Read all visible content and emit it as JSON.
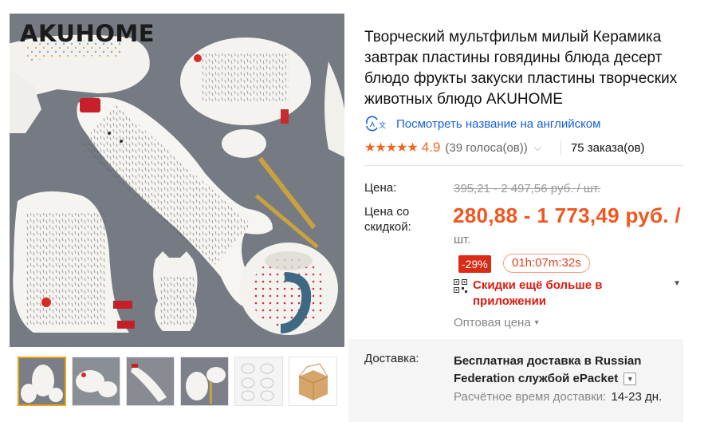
{
  "gallery": {
    "brand": "AKUHOME",
    "thumbnails": [
      {
        "name": "thumb-1-bear-set",
        "active": true
      },
      {
        "name": "thumb-2-cat-plates",
        "active": false
      },
      {
        "name": "thumb-3-bear-plate",
        "active": false
      },
      {
        "name": "thumb-4-table-setting",
        "active": false
      },
      {
        "name": "thumb-5-size-chart",
        "active": false
      },
      {
        "name": "thumb-6-packaging-box",
        "active": false
      }
    ]
  },
  "product": {
    "title": "Творческий мультфильм милый Керамика завтрак пластины говядины блюда десерт блюдо фрукты закуски пластины творческих животных блюдо AKUHOME",
    "translate_link": "Посмотреть название на английском",
    "rating": {
      "stars": "★★★★★",
      "score": "4.9",
      "votes": "(39 голоса(ов))",
      "orders": "75 заказа(ов)"
    }
  },
  "price": {
    "label_price": "Цена:",
    "old_price": "395,21 - 2 497,56 руб. / шт.",
    "label_discounted": "Цена со скидкой:",
    "new_price": "280,88 - 1 773,49 руб. /",
    "unit": "шт.",
    "discount": "-29%",
    "timer": "01h:07m:32s",
    "app_promo": "Скидки ещё больше в приложении",
    "wholesale": "Оптовая цена"
  },
  "shipping": {
    "label": "Доставка:",
    "text": "Бесплатная доставка в Russian Federation службой ePacket",
    "eta_label": "Расчётное время доставки:",
    "eta_days": "14-23 дн."
  },
  "colors": {
    "accent_orange": "#f0561e",
    "link_blue": "#1660d8",
    "promo_red": "#e01a10",
    "badge_red": "#d92b16",
    "thumb_active_border": "#f0a30a"
  }
}
